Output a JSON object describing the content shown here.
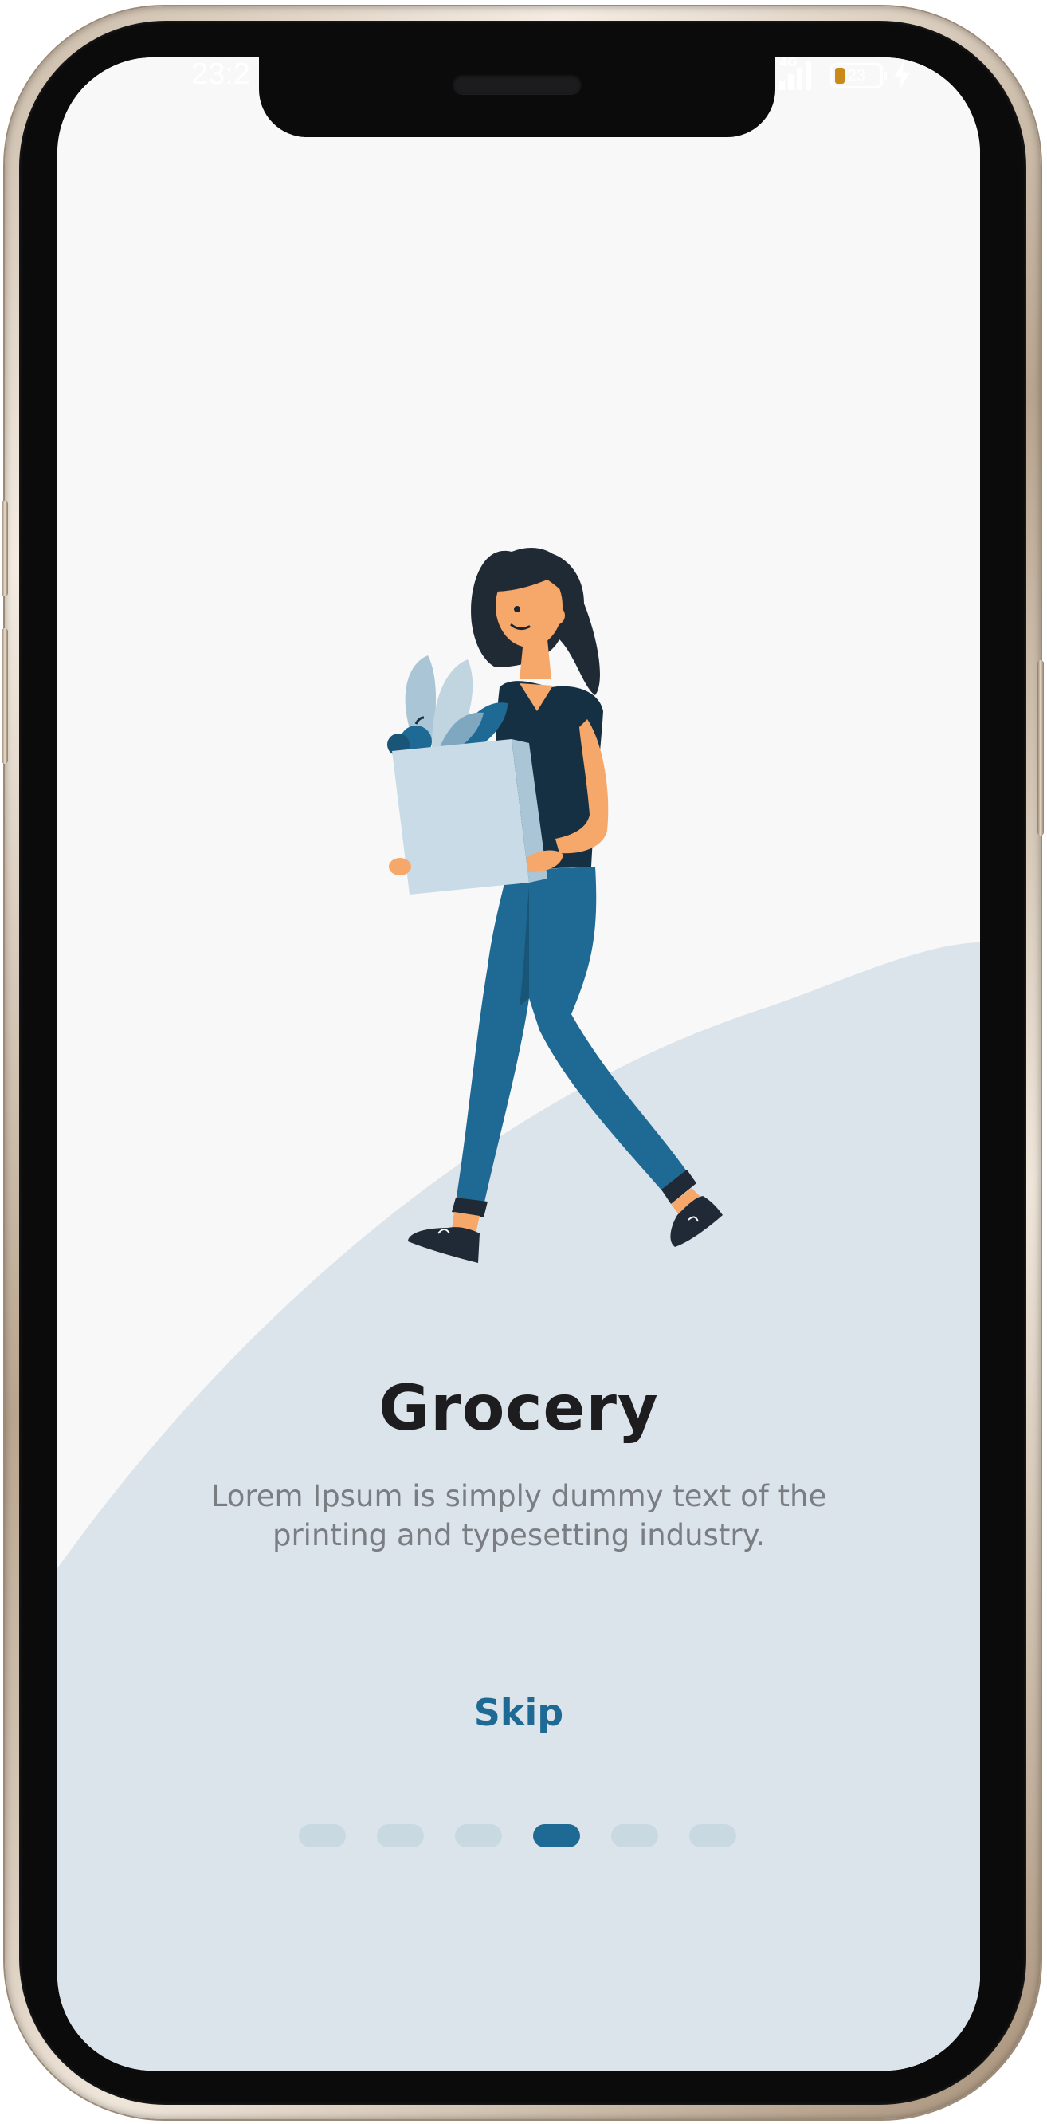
{
  "status_bar": {
    "time": "23:2",
    "network": "4G",
    "battery_level": "23",
    "battery_fill_fraction": 0.23,
    "signal_bars": 4,
    "charging": true
  },
  "onboarding": {
    "title": "Grocery",
    "description": "Lorem Ipsum is simply dummy text of the printing and typesetting industry.",
    "skip_label": "Skip",
    "illustration": "woman-carrying-grocery-bag-illustration",
    "page_count": 6,
    "active_page": 4
  },
  "colors": {
    "accent": "#1f6a94",
    "title": "#1d1d1f",
    "description": "#7a7e83",
    "background": "#f8f8f8",
    "wave": "#dbe4ea",
    "dot_inactive": "#c9d9e2"
  },
  "icons": [
    "signal-icon",
    "battery-icon",
    "charging-icon"
  ]
}
